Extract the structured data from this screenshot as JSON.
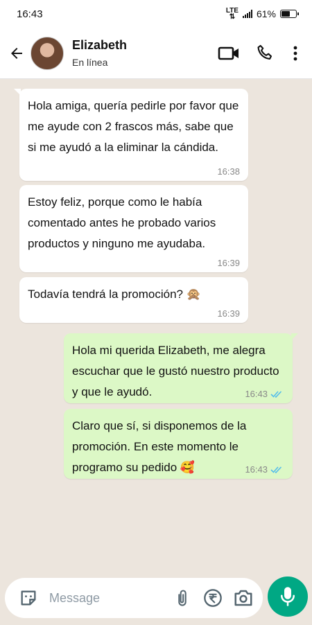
{
  "status_bar": {
    "time": "16:43",
    "network": "LTE",
    "battery_percent": "61%",
    "battery_level": 0.61
  },
  "header": {
    "contact_name": "Elizabeth",
    "contact_status": "En línea"
  },
  "messages": [
    {
      "direction": "incoming",
      "text": "Hola amiga, quería pedirle por favor que me ayude con 2 frascos más, sabe que si me ayudó a la eliminar la cándida.",
      "time": "16:38"
    },
    {
      "direction": "incoming",
      "text": "Estoy feliz, porque como le había comentado antes he probado varios productos y ninguno me ayudaba.",
      "time": "16:39"
    },
    {
      "direction": "incoming",
      "text": "Todavía tendrá la promoción? 🙊",
      "time": "16:39"
    },
    {
      "direction": "outgoing",
      "text": "Hola mi querida Elizabeth, me alegra escuchar que le gustó nuestro producto y que le ayudó.",
      "time": "16:43",
      "status": "read"
    },
    {
      "direction": "outgoing",
      "text": "Claro que sí, si disponemos de la promoción. En este momento le programo su pedido 🥰",
      "time": "16:43",
      "status": "read"
    }
  ],
  "input": {
    "placeholder": "Message"
  },
  "colors": {
    "incoming_bubble": "#ffffff",
    "outgoing_bubble": "#dcf8c6",
    "read_ticks": "#53bdeb",
    "mic_button": "#00a884"
  }
}
